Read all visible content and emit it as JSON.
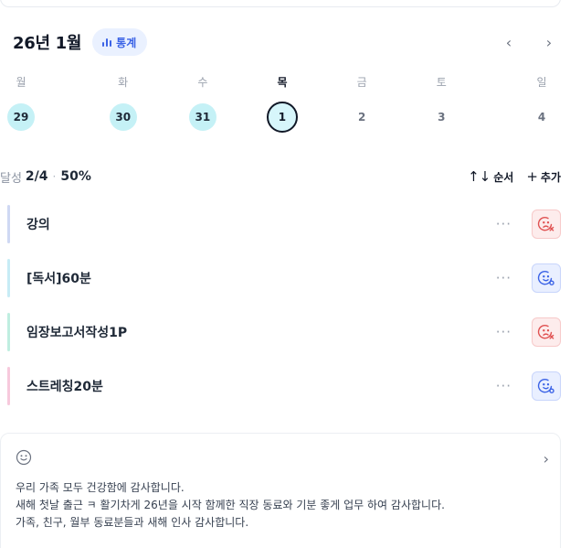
{
  "calendar": {
    "title": "26년 1월",
    "stats_label": "통계",
    "prev_icon": "‹",
    "next_icon": "›",
    "days": [
      {
        "dow": "월",
        "date": "29",
        "state": "filled"
      },
      {
        "dow": "화",
        "date": "30",
        "state": "filled"
      },
      {
        "dow": "수",
        "date": "31",
        "state": "filled"
      },
      {
        "dow": "목",
        "date": "1",
        "state": "today"
      },
      {
        "dow": "금",
        "date": "2",
        "state": "empty"
      },
      {
        "dow": "토",
        "date": "3",
        "state": "empty"
      },
      {
        "dow": "일",
        "date": "4",
        "state": "empty"
      }
    ]
  },
  "progress": {
    "label": "달성",
    "count": "2/4",
    "dot": "·",
    "percent": "50%",
    "sort_label": "순서",
    "sort_icon": "↑↓",
    "add_label": "추가",
    "add_icon": "+"
  },
  "tasks": [
    {
      "name": "강의",
      "bar_color": "#cfd8f3",
      "status": "fail"
    },
    {
      "name": "[독서]60분",
      "bar_color": "#c7ecf5",
      "status": "ok"
    },
    {
      "name": "임장보고서작성1P",
      "bar_color": "#bfeee0",
      "status": "fail"
    },
    {
      "name": "스트레칭20분",
      "bar_color": "#f7c9dc",
      "status": "ok"
    }
  ],
  "task_more": "···",
  "colors": {
    "fail": "#e05252",
    "ok": "#3b63e6"
  },
  "note": {
    "chevron": "›",
    "lines": [
      "우리 가족 모두 건강함에 감사합니다.",
      "새해 첫날 출근 ㅋ 활기차게 26년을 시작 함께한 직장 동료와 기분 좋게 업무 하여 감사합니다.",
      "가족, 친구, 월부 동료분들과 새해 인사 감사합니다."
    ]
  }
}
